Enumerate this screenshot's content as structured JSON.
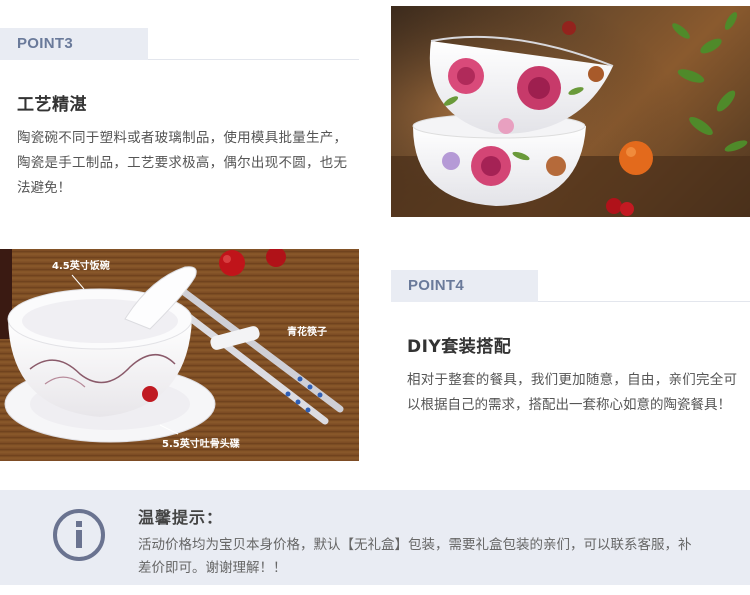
{
  "point3": {
    "tab": "POINT3",
    "title": "工艺精湛",
    "text": "陶瓷碗不同于塑料或者玻璃制品，使用模具批量生产，陶瓷是手工制品，工艺要求极高，偶尔出现不圆，也无法避免！"
  },
  "point4": {
    "tab": "POINT4",
    "title": "DIY套装搭配",
    "text": "相对于整套的餐具，我们更加随意，自由，亲们完全可以根据自己的需求，搭配出一套称心如意的陶瓷餐具！"
  },
  "photo2": {
    "label_bowl": "4.5英寸饭碗",
    "label_chopsticks": "青花筷子",
    "label_plate": "5.5英寸吐骨头碟"
  },
  "notice": {
    "title": "温馨提示：",
    "text": "活动价格均为宝贝本身价格，默认【无礼盒】包装，需要礼盒包装的亲们，可以联系客服，补差价即可。谢谢理解！！"
  },
  "icons": {
    "notice": "info-icon"
  },
  "colors": {
    "tab_bg": "#e9ecf3",
    "tab_text": "#6a7a9a",
    "notice_bg": "#e9ecf3",
    "icon": "#6a7390"
  }
}
